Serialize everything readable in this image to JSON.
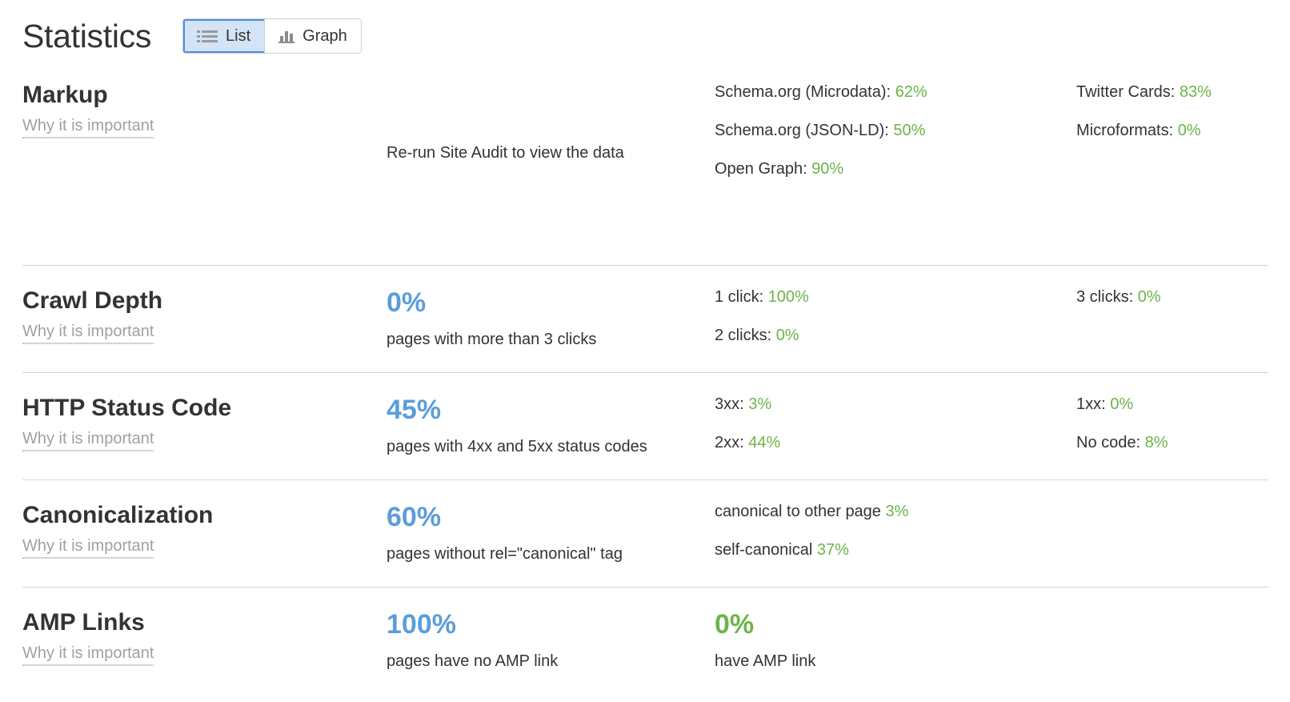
{
  "header": {
    "title": "Statistics",
    "toggle": {
      "list_label": "List",
      "graph_label": "Graph",
      "active": "List"
    }
  },
  "common": {
    "why_link": "Why it is important"
  },
  "colors": {
    "blue": "#5b9ddb",
    "green": "#6cb44a",
    "text": "#333333",
    "muted": "#a0a0a0",
    "divider": "#d6d6d6",
    "toggle_active_bg": "#d4e4f7",
    "toggle_active_border": "#4a90e2"
  },
  "rows": [
    {
      "title": "Markup",
      "why": "Why it is important",
      "note": "Re-run Site Audit to view the data",
      "metrics_a": [
        {
          "label": "Schema.org (Microdata):",
          "value": "62%"
        },
        {
          "label": "Schema.org (JSON-LD):",
          "value": "50%"
        },
        {
          "label": "Open Graph:",
          "value": "90%"
        }
      ],
      "metrics_b": [
        {
          "label": "Twitter Cards:",
          "value": "83%"
        },
        {
          "label": "Microformats:",
          "value": "0%"
        }
      ]
    },
    {
      "title": "Crawl Depth",
      "why": "Why it is important",
      "big_value": "0%",
      "big_color": "blue",
      "sub_text": "pages with more than 3 clicks",
      "metrics_a": [
        {
          "label": "1 click:",
          "value": "100%"
        },
        {
          "label": "2 clicks:",
          "value": "0%"
        }
      ],
      "metrics_b": [
        {
          "label": "3 clicks:",
          "value": "0%"
        }
      ]
    },
    {
      "title": "HTTP Status Code",
      "why": "Why it is important",
      "big_value": "45%",
      "big_color": "blue",
      "sub_text": "pages with 4xx and 5xx status codes",
      "metrics_a": [
        {
          "label": "3xx:",
          "value": "3%"
        },
        {
          "label": "2xx:",
          "value": "44%"
        }
      ],
      "metrics_b": [
        {
          "label": "1xx:",
          "value": "0%"
        },
        {
          "label": "No code:",
          "value": "8%"
        }
      ]
    },
    {
      "title": "Canonicalization",
      "why": "Why it is important",
      "big_value": "60%",
      "big_color": "blue",
      "sub_text": "pages without rel=\"canonical\" tag",
      "metrics_a": [
        {
          "label": "canonical to other page",
          "value": "3%"
        },
        {
          "label": "self-canonical",
          "value": "37%"
        }
      ],
      "metrics_b": []
    },
    {
      "title": "AMP Links",
      "why": "Why it is important",
      "big_value": "100%",
      "big_color": "blue",
      "sub_text": "pages have no AMP link",
      "second_big_value": "0%",
      "second_big_color": "green",
      "second_sub_text": "have AMP link",
      "metrics_a": [],
      "metrics_b": []
    }
  ]
}
